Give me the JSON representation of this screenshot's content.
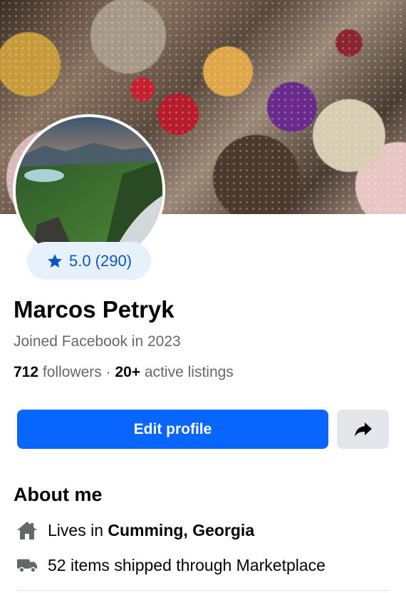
{
  "profile": {
    "name": "Marcos Petryk",
    "joined": "Joined Facebook in 2023",
    "rating": "5.0 (290)",
    "followers_count": "712",
    "followers_label": "followers",
    "separator": "·",
    "listings_count": "20+",
    "listings_label": "active listings"
  },
  "actions": {
    "edit_label": "Edit profile",
    "share_icon": "share-arrow-icon"
  },
  "about": {
    "title": "About me",
    "lives_prefix": "Lives in",
    "lives_location": "Cumming, Georgia",
    "shipped": "52 items shipped through Marketplace"
  },
  "icons": {
    "rating": "star-icon",
    "lives": "home-icon",
    "shipped": "truck-icon"
  },
  "colors": {
    "primary": "#0866ff",
    "rating_text": "#0a57c2",
    "rating_bg": "#e7f1fb",
    "secondary_text": "#65676b"
  }
}
